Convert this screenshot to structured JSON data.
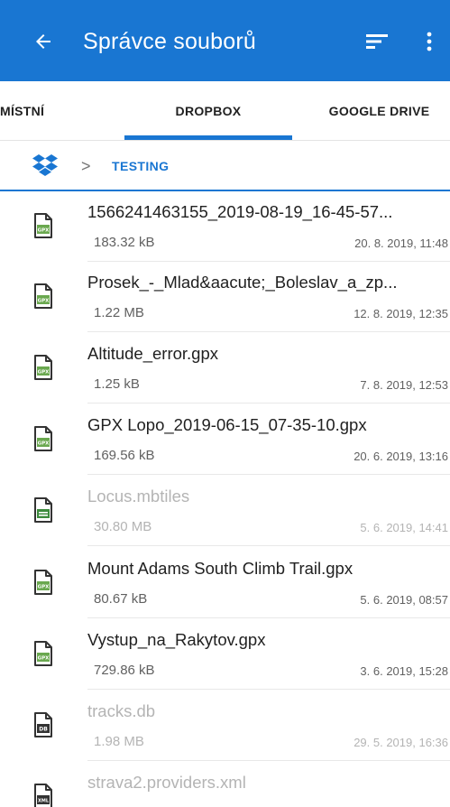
{
  "appbar": {
    "title": "Správce souborů",
    "back_icon": "arrow-left-icon",
    "sort_icon": "sort-icon",
    "more_icon": "more-vert-icon",
    "color": "#1976d2"
  },
  "tabs": [
    {
      "label": "MÍSTNÍ",
      "active": false
    },
    {
      "label": "DROPBOX",
      "active": true
    },
    {
      "label": "GOOGLE DRIVE",
      "active": false
    }
  ],
  "breadcrumb": {
    "root_icon": "dropbox-icon",
    "separator": ">",
    "current": "TESTING"
  },
  "files": [
    {
      "name": "1566241463155_2019-08-19_16-45-57...",
      "size": "183.32 kB",
      "date": "20. 8. 2019, 11:48",
      "type": "gpx",
      "dim": false
    },
    {
      "name": "Prosek_-_Mlad&aacute;_Boleslav_a_zp...",
      "size": "1.22 MB",
      "date": "12. 8. 2019, 12:35",
      "type": "gpx",
      "dim": false
    },
    {
      "name": "Altitude_error.gpx",
      "size": "1.25 kB",
      "date": "7. 8. 2019, 12:53",
      "type": "gpx",
      "dim": false
    },
    {
      "name": "GPX Lopo_2019-06-15_07-35-10.gpx",
      "size": "169.56 kB",
      "date": "20. 6. 2019, 13:16",
      "type": "gpx",
      "dim": false
    },
    {
      "name": "Locus.mbtiles",
      "size": "30.80 MB",
      "date": "5. 6. 2019, 14:41",
      "type": "generic",
      "dim": true
    },
    {
      "name": "Mount Adams South Climb Trail.gpx",
      "size": "80.67 kB",
      "date": "5. 6. 2019, 08:57",
      "type": "gpx",
      "dim": false
    },
    {
      "name": "Vystup_na_Rakytov.gpx",
      "size": "729.86 kB",
      "date": "3. 6. 2019, 15:28",
      "type": "gpx",
      "dim": false
    },
    {
      "name": "tracks.db",
      "size": "1.98 MB",
      "date": "29. 5. 2019, 16:36",
      "type": "db",
      "dim": true
    },
    {
      "name": "strava2.providers.xml",
      "size": "",
      "date": "",
      "type": "xml",
      "dim": true
    }
  ],
  "colors": {
    "accent": "#1976d2",
    "gpx_badge": "#6aa84f",
    "generic_badge": "#3d8b3d"
  }
}
